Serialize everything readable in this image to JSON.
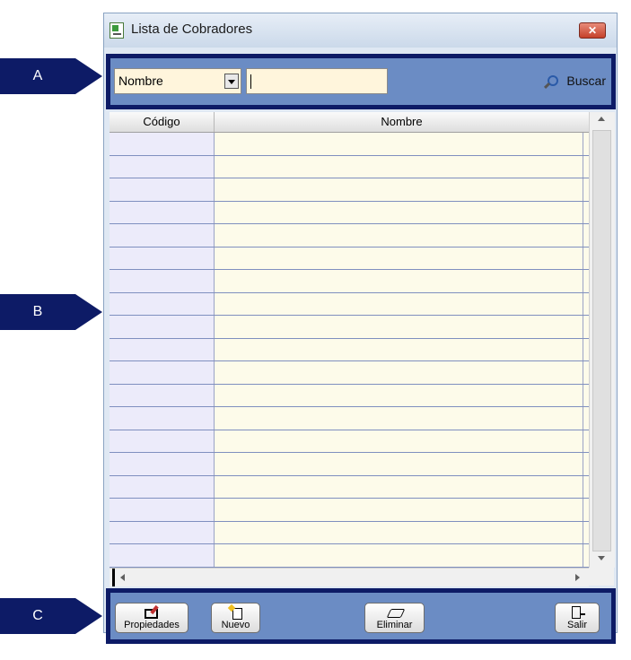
{
  "window": {
    "title": "Lista de Cobradores",
    "close_label": "✕"
  },
  "callouts": {
    "a": "A",
    "b": "B",
    "c": "C"
  },
  "search_bar": {
    "field_select_value": "Nombre",
    "search_value": "",
    "search_button_label": "Buscar"
  },
  "grid": {
    "columns": [
      "Código",
      "Nombre"
    ],
    "row_count": 19
  },
  "toolbar": {
    "propiedades_label": "Propiedades",
    "nuevo_label": "Nuevo",
    "eliminar_label": "Eliminar",
    "salir_label": "Salir"
  },
  "colors": {
    "callout_navy": "#0d1b66",
    "panel_blue": "#6b8cc4",
    "input_cream": "#fff5dc",
    "codigo_col_lavender": "#ecebfa",
    "nombre_col_cream": "#fdfbea"
  }
}
